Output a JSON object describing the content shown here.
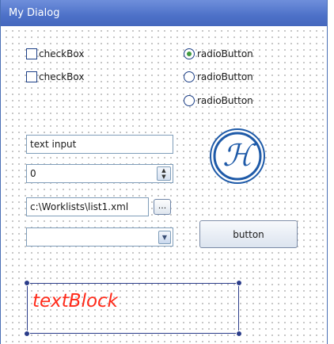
{
  "window": {
    "title": "My Dialog"
  },
  "checkboxes": [
    {
      "label": "checkBox",
      "checked": false
    },
    {
      "label": "checkBox",
      "checked": false
    }
  ],
  "radios": [
    {
      "label": "radioButton",
      "checked": true
    },
    {
      "label": "radioButton",
      "checked": false
    },
    {
      "label": "radioButton",
      "checked": false
    }
  ],
  "text_input": {
    "value": "text input"
  },
  "numeric_input": {
    "value": "0",
    "up_icon": "spin-up-icon",
    "down_icon": "spin-down-icon"
  },
  "file_input": {
    "value": "c:\\Worklists\\list1.xml",
    "browse_label": "..."
  },
  "combobox": {
    "value": "",
    "icon": "chevron-down-icon"
  },
  "button": {
    "label": "button"
  },
  "text_block": {
    "text": "textBlock",
    "color": "#ff2a1a"
  },
  "logo": {
    "glyph": "ℋ",
    "color": "#1e5aa8"
  },
  "colors": {
    "title_bar": "#4d71c8",
    "selection": "#2b3d8a"
  }
}
